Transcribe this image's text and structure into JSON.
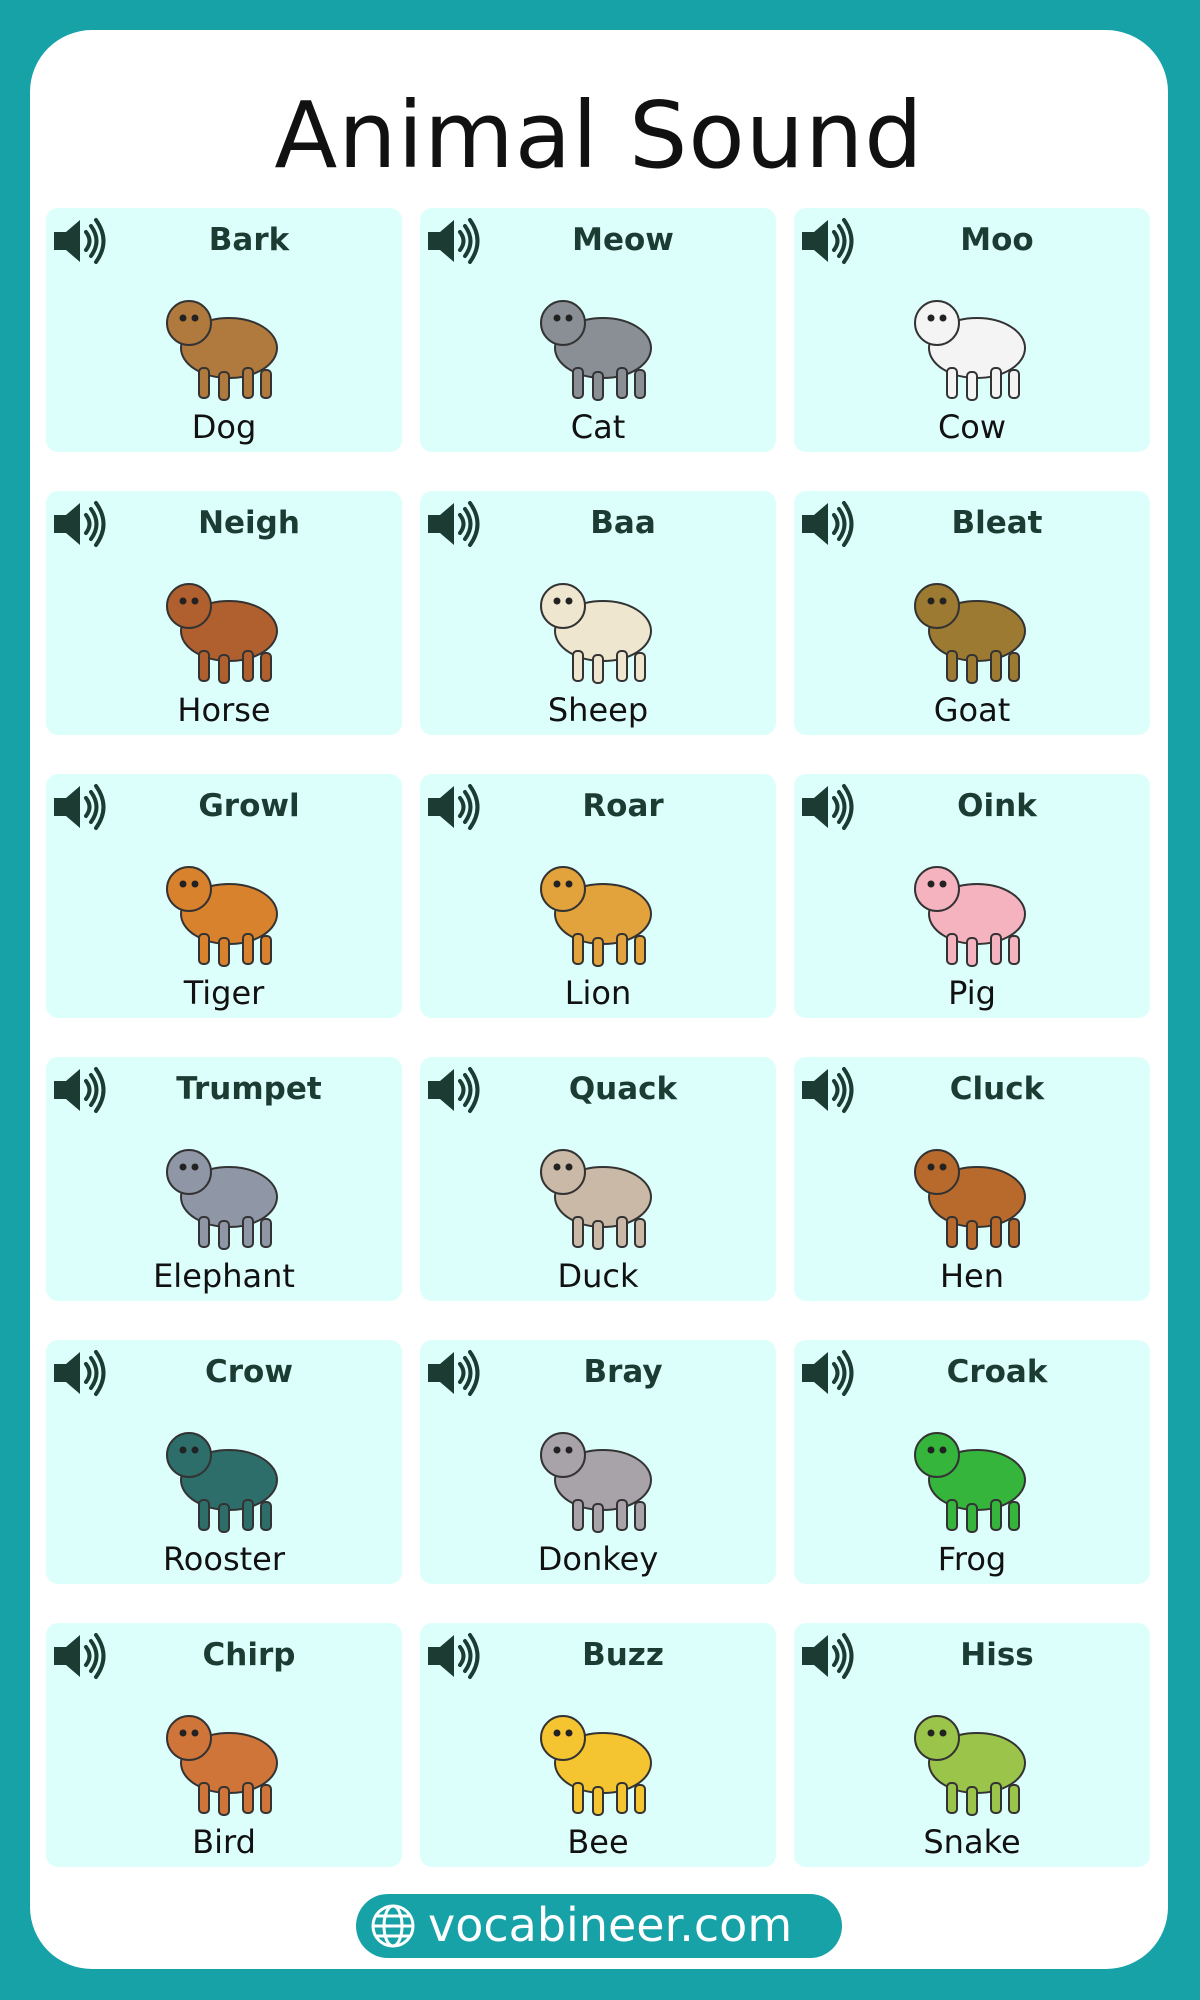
{
  "title": "Animal Sound",
  "cards": [
    {
      "sound": "Bark",
      "animal": "Dog",
      "icon": "dog-illustration",
      "color": "#b07a3f"
    },
    {
      "sound": "Meow",
      "animal": "Cat",
      "icon": "cat-illustration",
      "color": "#8a8f95"
    },
    {
      "sound": "Moo",
      "animal": "Cow",
      "icon": "cow-illustration",
      "color": "#f4f4f4"
    },
    {
      "sound": "Neigh",
      "animal": "Horse",
      "icon": "horse-illustration",
      "color": "#b0602e"
    },
    {
      "sound": "Baa",
      "animal": "Sheep",
      "icon": "sheep-illustration",
      "color": "#efe6cf"
    },
    {
      "sound": "Bleat",
      "animal": "Goat",
      "icon": "goat-illustration",
      "color": "#9c7a32"
    },
    {
      "sound": "Growl",
      "animal": "Tiger",
      "icon": "tiger-illustration",
      "color": "#d9822e"
    },
    {
      "sound": "Roar",
      "animal": "Lion",
      "icon": "lion-illustration",
      "color": "#e2a33c"
    },
    {
      "sound": "Oink",
      "animal": "Pig",
      "icon": "pig-illustration",
      "color": "#f5b3c0"
    },
    {
      "sound": "Trumpet",
      "animal": "Elephant",
      "icon": "elephant-illustration",
      "color": "#8f97a7"
    },
    {
      "sound": "Quack",
      "animal": "Duck",
      "icon": "duck-illustration",
      "color": "#c9b9a6"
    },
    {
      "sound": "Cluck",
      "animal": "Hen",
      "icon": "hen-illustration",
      "color": "#b86a2c"
    },
    {
      "sound": "Crow",
      "animal": "Rooster",
      "icon": "rooster-illustration",
      "color": "#2d6e6a"
    },
    {
      "sound": "Bray",
      "animal": "Donkey",
      "icon": "donkey-illustration",
      "color": "#a7a3a8"
    },
    {
      "sound": "Croak",
      "animal": "Frog",
      "icon": "frog-illustration",
      "color": "#35b53b"
    },
    {
      "sound": "Chirp",
      "animal": "Bird",
      "icon": "bird-illustration",
      "color": "#d0753a"
    },
    {
      "sound": "Buzz",
      "animal": "Bee",
      "icon": "bee-illustration",
      "color": "#f5c531"
    },
    {
      "sound": "Hiss",
      "animal": "Snake",
      "icon": "snake-illustration",
      "color": "#9bc44a"
    }
  ],
  "speaker_icon": "speaker-icon",
  "footer": {
    "icon": "globe-icon",
    "text": "vocabineer.com"
  },
  "colors": {
    "background": "#17a2a7",
    "card": "#ddfffc",
    "sound_text": "#1c3b33"
  }
}
